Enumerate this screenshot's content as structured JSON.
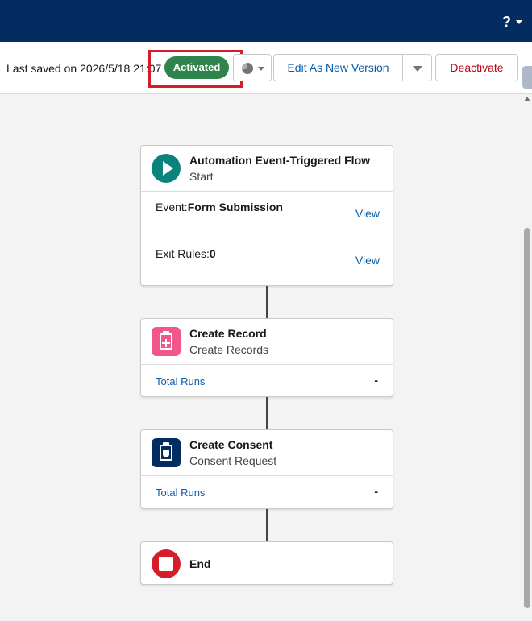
{
  "header": {
    "help_label": "?"
  },
  "toolbar": {
    "last_saved": "Last saved on 2026/5/18 21:07",
    "status": "Activated",
    "status_color": "#2e844a",
    "highlight_color": "#d61e2b",
    "menu_icon": "pie-chart-icon",
    "edit_label": "Edit As New Version",
    "deactivate_label": "Deactivate"
  },
  "flow": {
    "start": {
      "title": "Automation Event-Triggered Flow",
      "subtitle": "Start",
      "icon": "play-icon",
      "event_label": "Event:",
      "event_value": "Form Submission",
      "event_link": "View",
      "exit_label": "Exit Rules:",
      "exit_value": "0",
      "exit_link": "View"
    },
    "create_record": {
      "title": "Create Record",
      "subtitle": "Create Records",
      "icon": "clipboard-plus-icon",
      "runs_label": "Total Runs",
      "runs_value": "-"
    },
    "create_consent": {
      "title": "Create Consent",
      "subtitle": "Consent Request",
      "icon": "clipboard-shield-icon",
      "runs_label": "Total Runs",
      "runs_value": "-"
    },
    "end": {
      "title": "End",
      "icon": "stop-icon"
    }
  }
}
